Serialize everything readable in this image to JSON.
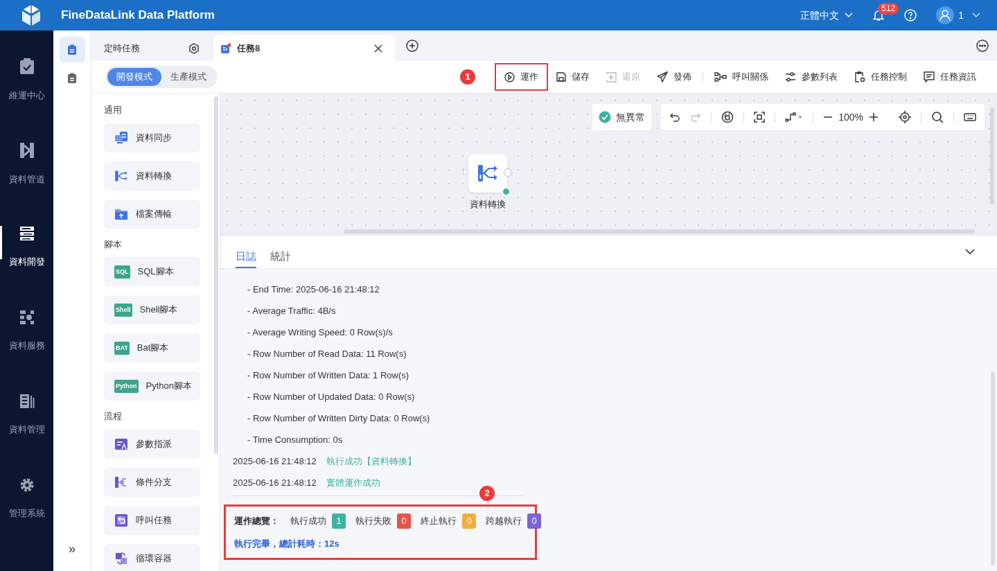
{
  "header": {
    "title": "FineDataLink Data Platform",
    "language": "正體中文",
    "notification_count": "512",
    "user": "1"
  },
  "nav": [
    {
      "label": "維運中心",
      "kind": "clipboard",
      "selected": false
    },
    {
      "label": "資料管道",
      "kind": "pipe",
      "selected": false
    },
    {
      "label": "資料開發",
      "kind": "dev",
      "selected": true
    },
    {
      "label": "資料服務",
      "kind": "service",
      "selected": false
    },
    {
      "label": "資料管理",
      "kind": "manage",
      "selected": false
    },
    {
      "label": "管理系統",
      "kind": "gear",
      "selected": false
    }
  ],
  "subnav": [
    {
      "selected": true
    },
    {
      "selected": false
    }
  ],
  "expand_button": "»",
  "tabs": [
    {
      "label": "定時任務",
      "kind": "settings",
      "selected": false
    },
    {
      "label": "任務8",
      "kind": "task",
      "selected": true
    }
  ],
  "mode_toggle": [
    {
      "label": "開發模式",
      "selected": true
    },
    {
      "label": "生產模式",
      "selected": false
    }
  ],
  "toolbar": {
    "marker": "1",
    "items": [
      {
        "label": "運作",
        "kind": "play",
        "disabled": false,
        "highlighted": true
      },
      {
        "label": "儲存",
        "kind": "save",
        "disabled": false,
        "highlighted": false
      },
      {
        "label": "還原",
        "kind": "restore",
        "disabled": true,
        "highlighted": false
      },
      {
        "label": "發佈",
        "kind": "send",
        "disabled": false,
        "highlighted": false
      },
      {
        "label": "呼叫關係",
        "kind": "relation",
        "disabled": false,
        "highlighted": false
      },
      {
        "label": "參數列表",
        "kind": "sliders",
        "disabled": false,
        "highlighted": false
      },
      {
        "label": "任務控制",
        "kind": "control",
        "disabled": false,
        "highlighted": false
      },
      {
        "label": "任務資訊",
        "kind": "info",
        "disabled": false,
        "highlighted": false
      }
    ]
  },
  "palette": [
    {
      "title": "通用",
      "items": [
        {
          "label": "資料同步",
          "kind": "sync"
        },
        {
          "label": "資料轉換",
          "kind": "transform"
        },
        {
          "label": "檔案傳輸",
          "kind": "folder"
        }
      ]
    },
    {
      "title": "腳本",
      "items": [
        {
          "label": "SQL腳本",
          "kind": "script",
          "tag": "SQL"
        },
        {
          "label": "Shell腳本",
          "kind": "script",
          "tag": "Shell"
        },
        {
          "label": "Bat腳本",
          "kind": "script",
          "tag": "BAT"
        },
        {
          "label": "Python腳本",
          "kind": "script",
          "tag": "Python"
        }
      ]
    },
    {
      "title": "流程",
      "items": [
        {
          "label": "參數指派",
          "kind": "param"
        },
        {
          "label": "條件分支",
          "kind": "branch"
        },
        {
          "label": "呼叫任務",
          "kind": "call"
        },
        {
          "label": "循環容器",
          "kind": "loop"
        }
      ]
    }
  ],
  "canvas": {
    "status": "無異常",
    "zoom": "100%",
    "node": {
      "label": "資料轉換"
    }
  },
  "log": {
    "tabs": [
      {
        "label": "日誌",
        "selected": true
      },
      {
        "label": "統計",
        "selected": false
      }
    ],
    "details": [
      "- End Time: 2025-06-16 21:48:12",
      "- Average Traffic: 4B/s",
      "- Average Writing Speed: 0 Row(s)/s",
      "- Row Number of Read Data: 11 Row(s)",
      "- Row Number of Written Data: 1 Row(s)",
      "- Row Number of Updated Data: 0 Row(s)",
      "- Row Number of Written Dirty Data: 0 Row(s)",
      "- Time Consumption: 0s"
    ],
    "entries": [
      {
        "time": "2025-06-16 21:48:12",
        "message": "執行成功【資料轉換】"
      },
      {
        "time": "2025-06-16 21:48:12",
        "message": "實體運作成功"
      }
    ],
    "marker": "2",
    "summary": {
      "highlighted": true,
      "title": "運作總覽：",
      "counts": [
        {
          "label": "執行成功",
          "count": "1",
          "color": "#3db3a2"
        },
        {
          "label": "執行失敗",
          "count": "0",
          "color": "#e5534b"
        },
        {
          "label": "終止執行",
          "count": "0",
          "color": "#f2ae3d"
        },
        {
          "label": "跨越執行",
          "count": "0",
          "color": "#7b64d3"
        }
      ],
      "footer": "執行完畢，總計耗時：12s"
    }
  }
}
